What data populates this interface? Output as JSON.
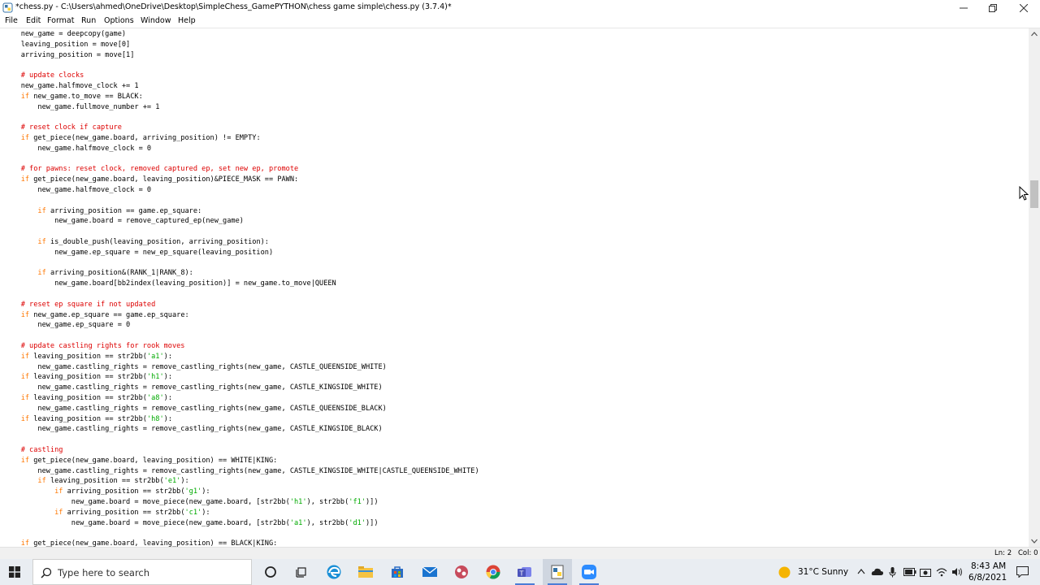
{
  "window": {
    "title": "*chess.py - C:\\Users\\ahmed\\OneDrive\\Desktop\\SimpleChess_GamePYTHON\\chess game simple\\chess.py (3.7.4)*",
    "icon": "python-idle-icon",
    "controls": [
      "minimize-icon",
      "maximize-icon",
      "close-icon"
    ]
  },
  "menu": [
    "File",
    "Edit",
    "Format",
    "Run",
    "Options",
    "Window",
    "Help"
  ],
  "code": {
    "lines": [
      [
        {
          "t": "    new_game = deepcopy(game)"
        }
      ],
      [
        {
          "t": "    leaving_position = move[0]"
        }
      ],
      [
        {
          "t": "    arriving_position = move[1]"
        }
      ],
      [
        {
          "t": ""
        }
      ],
      [
        {
          "t": "    "
        },
        {
          "t": "# update clocks",
          "c": "comment"
        }
      ],
      [
        {
          "t": "    new_game.halfmove_clock += 1"
        }
      ],
      [
        {
          "t": "    "
        },
        {
          "t": "if",
          "c": "keyword"
        },
        {
          "t": " new_game.to_move == BLACK:"
        }
      ],
      [
        {
          "t": "        new_game.fullmove_number += 1"
        }
      ],
      [
        {
          "t": ""
        }
      ],
      [
        {
          "t": "    "
        },
        {
          "t": "# reset clock if capture",
          "c": "comment"
        }
      ],
      [
        {
          "t": "    "
        },
        {
          "t": "if",
          "c": "keyword"
        },
        {
          "t": " get_piece(new_game.board, arriving_position) != EMPTY:"
        }
      ],
      [
        {
          "t": "        new_game.halfmove_clock = 0"
        }
      ],
      [
        {
          "t": ""
        }
      ],
      [
        {
          "t": "    "
        },
        {
          "t": "# for pawns: reset clock, removed captured ep, set new ep, promote",
          "c": "comment"
        }
      ],
      [
        {
          "t": "    "
        },
        {
          "t": "if",
          "c": "keyword"
        },
        {
          "t": " get_piece(new_game.board, leaving_position)&PIECE_MASK == PAWN:"
        }
      ],
      [
        {
          "t": "        new_game.halfmove_clock = 0"
        }
      ],
      [
        {
          "t": ""
        }
      ],
      [
        {
          "t": "        "
        },
        {
          "t": "if",
          "c": "keyword"
        },
        {
          "t": " arriving_position == game.ep_square:"
        }
      ],
      [
        {
          "t": "            new_game.board = remove_captured_ep(new_game)"
        }
      ],
      [
        {
          "t": ""
        }
      ],
      [
        {
          "t": "        "
        },
        {
          "t": "if",
          "c": "keyword"
        },
        {
          "t": " is_double_push(leaving_position, arriving_position):"
        }
      ],
      [
        {
          "t": "            new_game.ep_square = new_ep_square(leaving_position)"
        }
      ],
      [
        {
          "t": ""
        }
      ],
      [
        {
          "t": "        "
        },
        {
          "t": "if",
          "c": "keyword"
        },
        {
          "t": " arriving_position&(RANK_1|RANK_8):"
        }
      ],
      [
        {
          "t": "            new_game.board[bb2index(leaving_position)] = new_game.to_move|QUEEN"
        }
      ],
      [
        {
          "t": ""
        }
      ],
      [
        {
          "t": "    "
        },
        {
          "t": "# reset ep square if not updated",
          "c": "comment"
        }
      ],
      [
        {
          "t": "    "
        },
        {
          "t": "if",
          "c": "keyword"
        },
        {
          "t": " new_game.ep_square == game.ep_square:"
        }
      ],
      [
        {
          "t": "        new_game.ep_square = 0"
        }
      ],
      [
        {
          "t": ""
        }
      ],
      [
        {
          "t": "    "
        },
        {
          "t": "# update castling rights for rook moves",
          "c": "comment"
        }
      ],
      [
        {
          "t": "    "
        },
        {
          "t": "if",
          "c": "keyword"
        },
        {
          "t": " leaving_position == str2bb("
        },
        {
          "t": "'a1'",
          "c": "string"
        },
        {
          "t": "):"
        }
      ],
      [
        {
          "t": "        new_game.castling_rights = remove_castling_rights(new_game, CASTLE_QUEENSIDE_WHITE)"
        }
      ],
      [
        {
          "t": "    "
        },
        {
          "t": "if",
          "c": "keyword"
        },
        {
          "t": " leaving_position == str2bb("
        },
        {
          "t": "'h1'",
          "c": "string"
        },
        {
          "t": "):"
        }
      ],
      [
        {
          "t": "        new_game.castling_rights = remove_castling_rights(new_game, CASTLE_KINGSIDE_WHITE)"
        }
      ],
      [
        {
          "t": "    "
        },
        {
          "t": "if",
          "c": "keyword"
        },
        {
          "t": " leaving_position == str2bb("
        },
        {
          "t": "'a8'",
          "c": "string"
        },
        {
          "t": "):"
        }
      ],
      [
        {
          "t": "        new_game.castling_rights = remove_castling_rights(new_game, CASTLE_QUEENSIDE_BLACK)"
        }
      ],
      [
        {
          "t": "    "
        },
        {
          "t": "if",
          "c": "keyword"
        },
        {
          "t": " leaving_position == str2bb("
        },
        {
          "t": "'h8'",
          "c": "string"
        },
        {
          "t": "):"
        }
      ],
      [
        {
          "t": "        new_game.castling_rights = remove_castling_rights(new_game, CASTLE_KINGSIDE_BLACK)"
        }
      ],
      [
        {
          "t": ""
        }
      ],
      [
        {
          "t": "    "
        },
        {
          "t": "# castling",
          "c": "comment"
        }
      ],
      [
        {
          "t": "    "
        },
        {
          "t": "if",
          "c": "keyword"
        },
        {
          "t": " get_piece(new_game.board, leaving_position) == WHITE|KING:"
        }
      ],
      [
        {
          "t": "        new_game.castling_rights = remove_castling_rights(new_game, CASTLE_KINGSIDE_WHITE|CASTLE_QUEENSIDE_WHITE)"
        }
      ],
      [
        {
          "t": "        "
        },
        {
          "t": "if",
          "c": "keyword"
        },
        {
          "t": " leaving_position == str2bb("
        },
        {
          "t": "'e1'",
          "c": "string"
        },
        {
          "t": "):"
        }
      ],
      [
        {
          "t": "            "
        },
        {
          "t": "if",
          "c": "keyword"
        },
        {
          "t": " arriving_position == str2bb("
        },
        {
          "t": "'g1'",
          "c": "string"
        },
        {
          "t": "):"
        }
      ],
      [
        {
          "t": "                new_game.board = move_piece(new_game.board, [str2bb("
        },
        {
          "t": "'h1'",
          "c": "string"
        },
        {
          "t": "), str2bb("
        },
        {
          "t": "'f1'",
          "c": "string"
        },
        {
          "t": ")])"
        }
      ],
      [
        {
          "t": "            "
        },
        {
          "t": "if",
          "c": "keyword"
        },
        {
          "t": " arriving_position == str2bb("
        },
        {
          "t": "'c1'",
          "c": "string"
        },
        {
          "t": "):"
        }
      ],
      [
        {
          "t": "                new_game.board = move_piece(new_game.board, [str2bb("
        },
        {
          "t": "'a1'",
          "c": "string"
        },
        {
          "t": "), str2bb("
        },
        {
          "t": "'d1'",
          "c": "string"
        },
        {
          "t": ")])"
        }
      ],
      [
        {
          "t": ""
        }
      ],
      [
        {
          "t": "    "
        },
        {
          "t": "if",
          "c": "keyword"
        },
        {
          "t": " get_piece(new_game.board, leaving_position) == BLACK|KING:"
        }
      ]
    ]
  },
  "status": {
    "line": "Ln: 2",
    "col": "Col: 0"
  },
  "taskbar": {
    "search_placeholder": "Type here to search",
    "apps": [
      "cortana-icon",
      "task-view-icon",
      "edge-icon",
      "file-explorer-icon",
      "store-icon",
      "mail-icon",
      "app-icon",
      "chrome-icon",
      "teams-icon",
      "python-idle-icon",
      "zoom-icon"
    ],
    "weather": "31°C  Sunny",
    "time": "8:43 AM",
    "date": "6/8/2021"
  },
  "colors": {
    "comment": "#dd0000",
    "keyword": "#ff7700",
    "string": "#00aa00",
    "accent": "#4b7dd6"
  }
}
